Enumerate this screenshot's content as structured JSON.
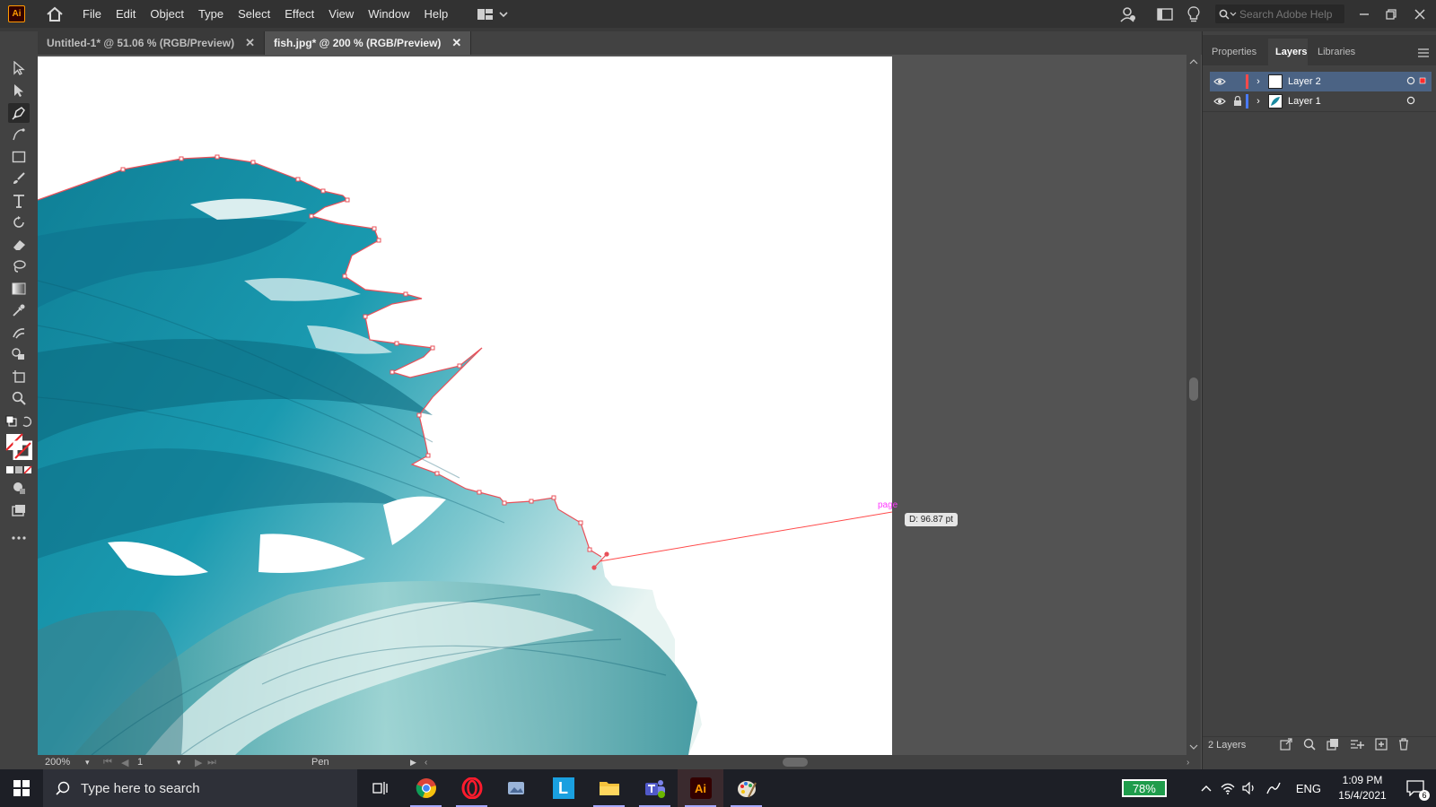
{
  "app": {
    "logo": "Ai",
    "name": "Adobe Illustrator"
  },
  "menu": [
    "File",
    "Edit",
    "Object",
    "Type",
    "Select",
    "Effect",
    "View",
    "Window",
    "Help"
  ],
  "search": {
    "placeholder": "Search Adobe Help"
  },
  "tabs": [
    {
      "label": "Untitled-1* @ 51.06 % (RGB/Preview)",
      "active": false
    },
    {
      "label": "fish.jpg* @ 200 % (RGB/Preview)",
      "active": true
    }
  ],
  "tools": [
    "selection-tool-icon",
    "direct-selection-tool-icon",
    "pen-tool-icon",
    "curvature-tool-icon",
    "rectangle-tool-icon",
    "paintbrush-tool-icon",
    "type-tool-icon",
    "rotate-tool-icon",
    "eraser-tool-icon",
    "lasso-tool-icon",
    "gradient-tool-icon",
    "eyedropper-tool-icon",
    "puppet-warp-tool-icon",
    "shape-builder-tool-icon",
    "artboard-tool-icon",
    "zoom-tool-icon"
  ],
  "canvas": {
    "smart_guide_label": "page",
    "measure_tooltip": "D: 96.87 pt"
  },
  "status": {
    "zoom": "200%",
    "artboard": "1",
    "tool": "Pen"
  },
  "panel": {
    "tabs": [
      "Properties",
      "Layers",
      "Libraries"
    ],
    "active_tab": "Layers",
    "layers": [
      {
        "name": "Layer 2",
        "color": "#ff4a4a",
        "selected": true,
        "locked": false
      },
      {
        "name": "Layer 1",
        "color": "#4a7bff",
        "selected": false,
        "locked": true
      }
    ],
    "footer": "2 Layers"
  },
  "taskbar": {
    "search_placeholder": "Type here to search",
    "battery": "78%",
    "language": "ENG",
    "time": "1:09 PM",
    "date": "15/4/2021",
    "notifications": "6",
    "apps": [
      "task-view-icon",
      "chrome-icon",
      "opera-icon",
      "photos-icon",
      "l-app-icon",
      "file-explorer-icon",
      "teams-icon",
      "illustrator-icon",
      "paint-icon"
    ]
  },
  "colors": {
    "accent_path": "#e8515a",
    "smart_guide": "#ff3bff",
    "fish_teal": "#1a8aa0"
  }
}
